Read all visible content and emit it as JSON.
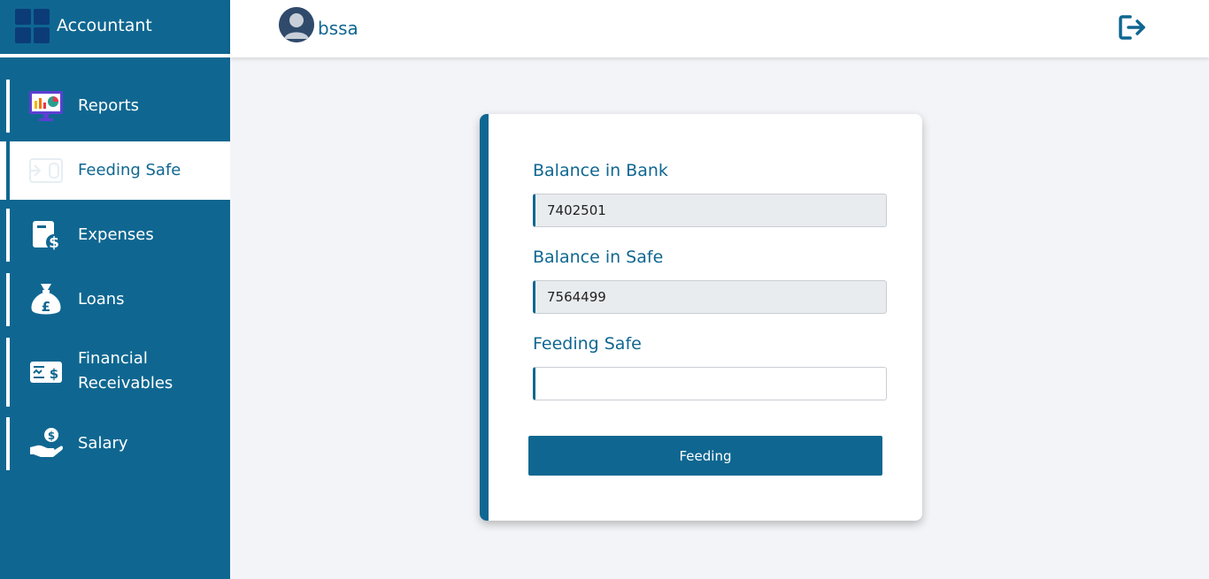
{
  "brand": {
    "title": "Accountant"
  },
  "user": {
    "name": "bssa"
  },
  "header": {
    "logout_icon": "logout-icon"
  },
  "sidebar": {
    "items": [
      {
        "label": "Reports",
        "icon": "reports-monitor-icon"
      },
      {
        "label": "Feeding Safe",
        "icon": "safe-transfer-icon",
        "active": true
      },
      {
        "label": "Expenses",
        "icon": "expenses-icon"
      },
      {
        "label": "Loans",
        "icon": "money-bag-pound-icon"
      },
      {
        "label": "Financial Receivables",
        "icon": "receivable-cheque-icon"
      },
      {
        "label": "Salary",
        "icon": "salary-hand-icon"
      }
    ]
  },
  "form": {
    "bank_label": "Balance in Bank",
    "bank_value": "7402501",
    "safe_label": "Balance in Safe",
    "safe_value": "7564499",
    "feeding_label": "Feeding Safe",
    "feeding_value": "",
    "submit_label": "Feeding"
  },
  "colors": {
    "primary": "#0f6791",
    "background": "#f3f4f7"
  }
}
